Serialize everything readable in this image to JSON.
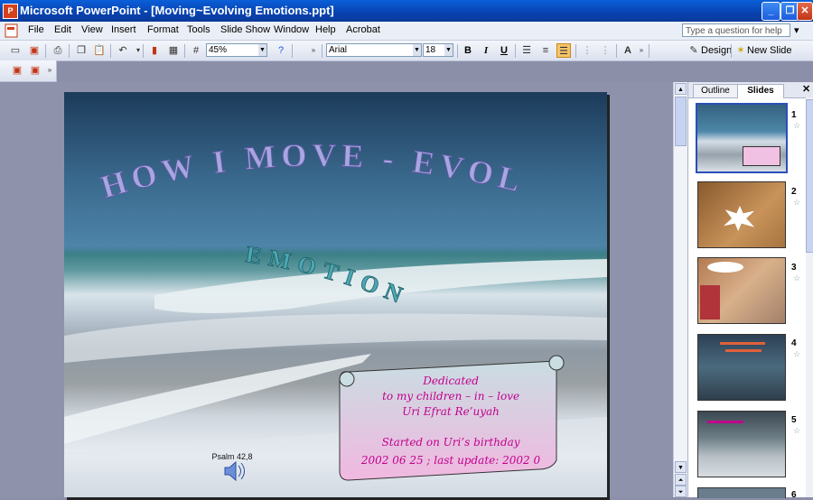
{
  "window": {
    "title": "Microsoft PowerPoint - [Moving~Evolving Emotions.ppt]",
    "app_icon": "P"
  },
  "menu": [
    "File",
    "Edit",
    "View",
    "Insert",
    "Format",
    "Tools",
    "Slide Show",
    "Window",
    "Help",
    "Acrobat"
  ],
  "help": {
    "placeholder": "Type a question for help"
  },
  "toolbar": {
    "zoom": "45%",
    "font": "Arial",
    "size": "18",
    "bold": "B",
    "italic": "I",
    "underline": "U",
    "design": "Design",
    "new_slide": "New Slide"
  },
  "slide": {
    "title_line1": "HOW  I  MOVE - EVOLVE",
    "title_line2": "EMOTIONS",
    "caption": "Psalm 42,8",
    "scroll_lines": [
      "Dedicated",
      "to  my  children – in – love",
      "Uri    Efrat    Re’uyah",
      "",
      "Started on Uri’s birthday",
      "2002  06  25 ; last update: 2002  0"
    ]
  },
  "pane": {
    "tab_outline": "Outline",
    "tab_slides": "Slides",
    "slide_numbers": [
      "1",
      "2",
      "3",
      "4",
      "5",
      "6"
    ]
  },
  "colors": {
    "title_blue": "#0842b0",
    "wordart": "#a8a6e0",
    "scroll_text": "#c2008c",
    "selection": "#2a4fb8"
  }
}
